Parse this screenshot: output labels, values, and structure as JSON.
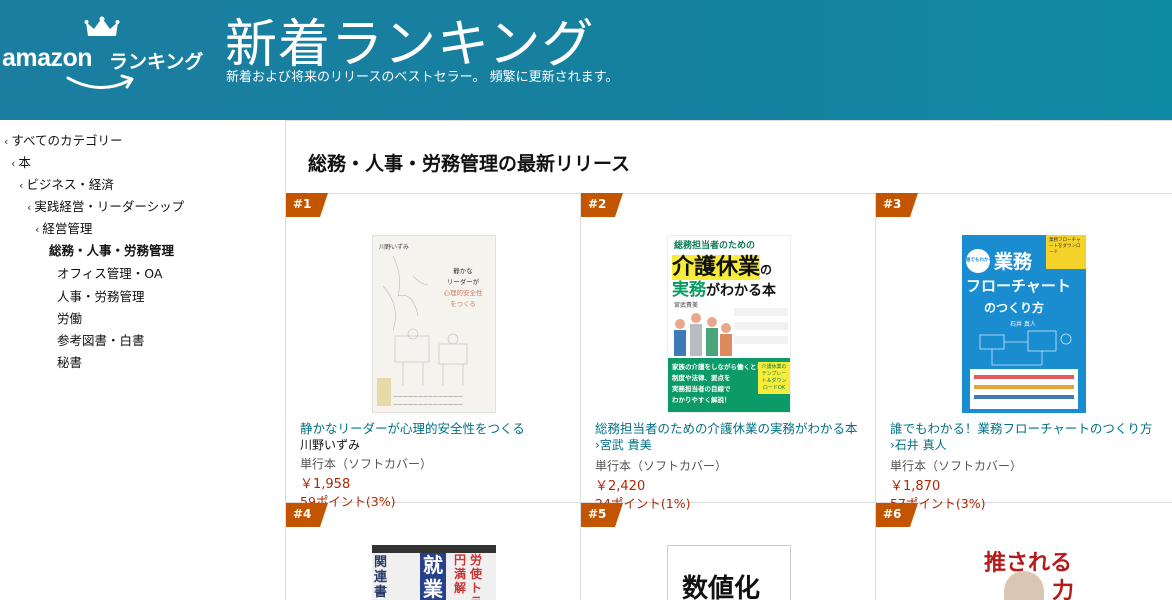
{
  "banner": {
    "logo_amazon": "amazon",
    "logo_ranking": "ランキング",
    "title": "新着ランキング",
    "subtitle": "新着および将来のリリースのベストセラー。 頻繁に更新されます。"
  },
  "sidebar": {
    "items": [
      {
        "label": "すべてのカテゴリー"
      },
      {
        "label": "本"
      },
      {
        "label": "ビジネス・経済"
      },
      {
        "label": "実践経営・リーダーシップ"
      },
      {
        "label": "経営管理"
      },
      {
        "label": "総務・人事・労務管理"
      },
      {
        "label": "オフィス管理・OA"
      },
      {
        "label": "人事・労務管理"
      },
      {
        "label": "労働"
      },
      {
        "label": "参考図書・白書"
      },
      {
        "label": "秘書"
      }
    ]
  },
  "main": {
    "heading": "総務・人事・労務管理の最新リリース",
    "products": [
      {
        "rank": "#1",
        "title": "静かなリーダーが心理的安全性をつくる",
        "author": "川野いずみ",
        "format": "単行本（ソフトカバー）",
        "price": "￥1,958",
        "points": "59ポイント(3%)",
        "cover": {
          "author": "川野いずみ",
          "title_lines": [
            "静かな",
            "リーダーが",
            "心理的安全性",
            "をつくる"
          ]
        }
      },
      {
        "rank": "#2",
        "title": "総務担当者のための介護休業の実務がわかる本",
        "author": "›宮武 貴美",
        "format": "単行本（ソフトカバー）",
        "price": "￥2,420",
        "points": "24ポイント(1%)",
        "cover": {
          "top": "総務担当者のための",
          "main1": "介護休業",
          "suffix1": "の",
          "main2": "実務",
          "suffix2": "がわかる本",
          "author": "宮武貴美",
          "band": [
            "家族の介護をしながら働くときの",
            "制度や法律、要点を",
            "実務担当者の目線で",
            "わかりやすく解説！"
          ],
          "badge": "介護休業のテンプレート＆ダウンロードOK"
        }
      },
      {
        "rank": "#3",
        "title": "誰でもわかる！業務フローチャートのつくり方",
        "author": "›石井 真人",
        "format": "単行本（ソフトカバー）",
        "price": "￥1,870",
        "points": "57ポイント(3%)",
        "cover": {
          "tag": "誰でもわかる!",
          "line1": "業務",
          "line2": "フローチャート",
          "line3": "のつくり方",
          "author": "石井 真人",
          "corner": "業務フローチャートをダウンロード"
        }
      },
      {
        "rank": "#4",
        "cover": {
          "a": "関連書",
          "b": "就業",
          "c": "労使トラ",
          "d": "円満解"
        }
      },
      {
        "rank": "#5",
        "cover": {
          "a": "数値化"
        }
      },
      {
        "rank": "#6",
        "cover": {
          "a": "推される",
          "b": "力"
        }
      }
    ]
  },
  "colors": {
    "banner": "#16809f",
    "badge": "#c45500",
    "link": "#007185",
    "price": "#b12704"
  }
}
